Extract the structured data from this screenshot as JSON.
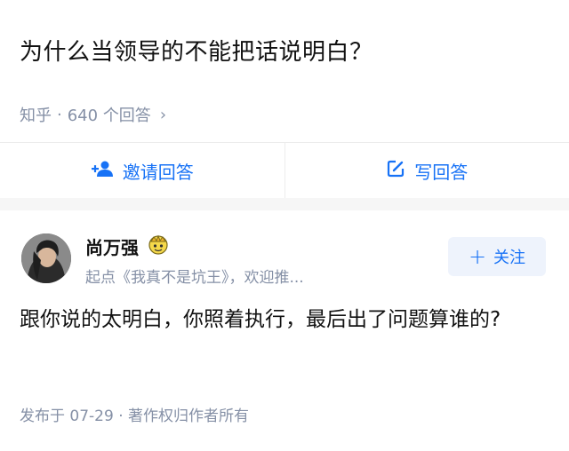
{
  "question": {
    "title": "为什么当领导的不能把话说明白？"
  },
  "meta": {
    "source": "知乎",
    "dot": "·",
    "answer_count": "640 个回答",
    "chevron": "›"
  },
  "actions": {
    "invite_icon": "person-add-icon",
    "invite_label": "邀请回答",
    "write_icon": "pencil-box-icon",
    "write_label": "写回答",
    "accent": "#1772f6"
  },
  "answer": {
    "author_name": "尚万强",
    "author_badge": "crown-badge-icon",
    "author_bio": "起点《我真不是坑王》，欢迎推...",
    "follow_plus": "+",
    "follow_label": "关注",
    "content": "跟你说的太明白，你照着执行，最后出了问题算谁的?",
    "footer": "发布于 07-29 · 著作权归作者所有"
  }
}
